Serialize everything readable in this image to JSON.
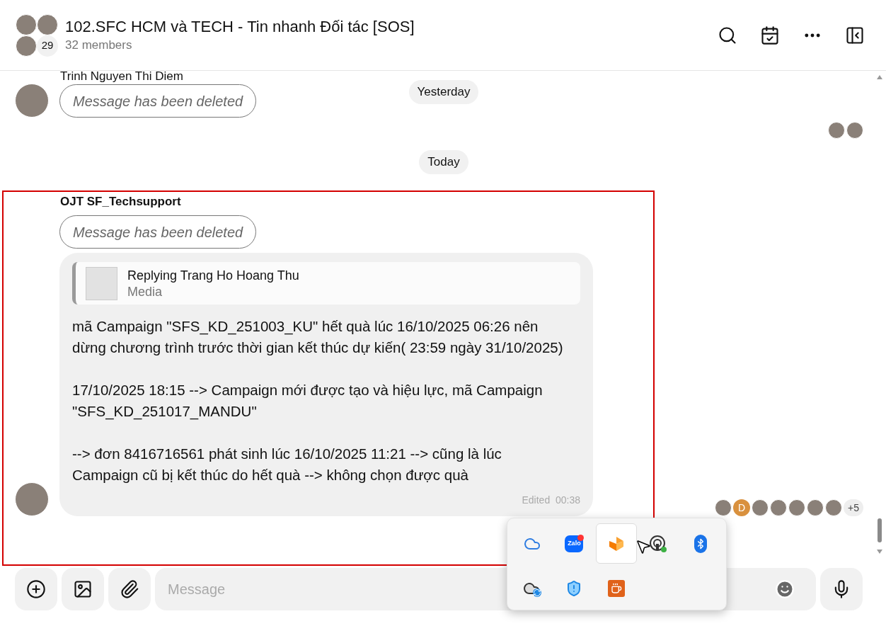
{
  "header": {
    "title": "102.SFC HCM và TECH - Tin nhanh Đối tác [SOS]",
    "members": "32 members",
    "avatar_count": "29"
  },
  "date_chips": [
    "Yesterday",
    "Today"
  ],
  "messages": [
    {
      "sender": "Trinh Nguyen Thi Diem",
      "deleted_text": "Message has been deleted",
      "seen_by": [
        {
          "kind": "photo"
        },
        {
          "kind": "photo"
        }
      ]
    },
    {
      "sender": "OJT SF_Techsupport",
      "deleted_text": "Message has been deleted",
      "reply": {
        "title": "Replying Trang Ho Hoang Thu",
        "subtitle": "Media"
      },
      "paragraphs": [
        "mã Campaign \"SFS_KD_251003_KU\" hết quà lúc 16/10/2025 06:26 nên dừng chương trình trước thời gian kết thúc dự kiến( 23:59 ngày 31/10/2025)",
        "17/10/2025 18:15 --> Campaign mới được tạo và hiệu lực, mã Campaign \"SFS_KD_251017_MANDU\"",
        "--> đơn 8416716561 phát sinh lúc 16/10/2025 11:21 --> cũng là lúc Campaign cũ bị kết thúc do hết quà --> không chọn được quà"
      ],
      "edited": "Edited  00:38",
      "seen_by": [
        {
          "kind": "photo"
        },
        {
          "kind": "initial",
          "text": "D"
        },
        {
          "kind": "photo"
        },
        {
          "kind": "photo"
        },
        {
          "kind": "photo"
        },
        {
          "kind": "photo"
        },
        {
          "kind": "photo"
        }
      ],
      "seen_more": "+5"
    }
  ],
  "composer": {
    "placeholder": "Message"
  },
  "tray_popup": {
    "items": [
      {
        "kind": "cloud",
        "selected": false,
        "badge": false
      },
      {
        "kind": "zalo",
        "label": "Zalo",
        "selected": false,
        "badge": true
      },
      {
        "kind": "orange-logo",
        "selected": true,
        "badge": false
      },
      {
        "kind": "keyhole",
        "selected": false,
        "badge": false
      },
      {
        "kind": "bluetooth",
        "selected": false,
        "badge": false
      },
      {
        "kind": "cloud-sync",
        "selected": false,
        "badge": false
      },
      {
        "kind": "shield",
        "selected": false,
        "badge": false
      },
      {
        "kind": "cup",
        "selected": false,
        "badge": false
      }
    ]
  }
}
